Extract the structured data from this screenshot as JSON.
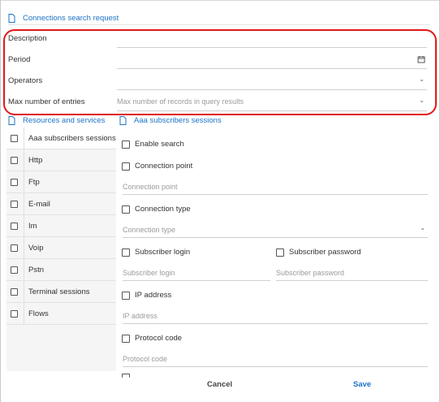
{
  "header": {
    "title": "Connections search request"
  },
  "form": {
    "description_label": "Description",
    "period_label": "Period",
    "operators_label": "Operators",
    "max_entries_label": "Max number of entries",
    "max_entries_placeholder": "Max number of records in query results"
  },
  "left_panel": {
    "title": "Resources and services",
    "items": [
      {
        "label": "Aaa subscribers sessions"
      },
      {
        "label": "Http"
      },
      {
        "label": "Ftp"
      },
      {
        "label": "E-mail"
      },
      {
        "label": "Im"
      },
      {
        "label": "Voip"
      },
      {
        "label": "Pstn"
      },
      {
        "label": "Terminal sessions"
      },
      {
        "label": "Flows"
      }
    ]
  },
  "right_panel": {
    "title": "Aaa subscribers sessions",
    "enable_search": "Enable search",
    "connection_point": "Connection point",
    "connection_point_placeholder": "Connection point",
    "connection_type": "Connection type",
    "connection_type_placeholder": "Connection type",
    "subscriber_login": "Subscriber login",
    "subscriber_login_placeholder": "Subscriber login",
    "subscriber_password": "Subscriber password",
    "subscriber_password_placeholder": "Subscriber password",
    "ip_address": "IP address",
    "ip_address_placeholder": "IP address",
    "protocol_code": "Protocol code",
    "protocol_code_placeholder": "Protocol code"
  },
  "footer": {
    "cancel": "Cancel",
    "save": "Save"
  },
  "colors": {
    "accent": "#1a73c8",
    "highlight": "#e01818"
  },
  "icons": {
    "header": "document-icon",
    "period": "calendar-icon",
    "dropdown": "chevron-down-icon"
  }
}
